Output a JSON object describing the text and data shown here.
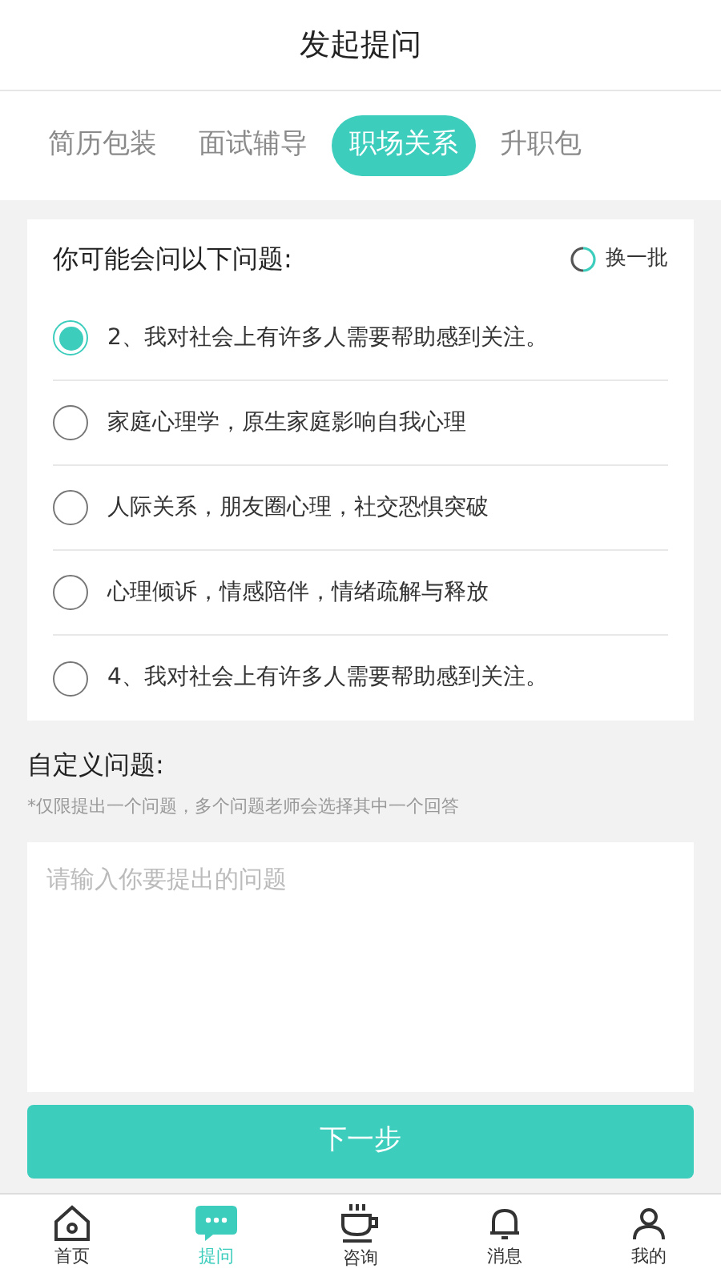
{
  "header": {
    "title": "发起提问"
  },
  "tabs": [
    {
      "label": "简历包装",
      "selected": false
    },
    {
      "label": "面试辅导",
      "selected": false
    },
    {
      "label": "职场关系",
      "selected": true
    },
    {
      "label": "升职包",
      "selected": false
    }
  ],
  "suggestions": {
    "title": "你可能会问以下问题:",
    "refresh": "换一批",
    "options": [
      {
        "label": "2、我对社会上有许多人需要帮助感到关注。",
        "selected": true
      },
      {
        "label": "家庭心理学，原生家庭影响自我心理",
        "selected": false
      },
      {
        "label": "人际关系，朋友圈心理，社交恐惧突破",
        "selected": false
      },
      {
        "label": "心理倾诉，情感陪伴，情绪疏解与释放",
        "selected": false
      },
      {
        "label": "4、我对社会上有许多人需要帮助感到关注。",
        "selected": false
      }
    ]
  },
  "custom": {
    "title": "自定义问题:",
    "note": "*仅限提出一个问题，多个问题老师会选择其中一个回答",
    "placeholder": "请输入你要提出的问题"
  },
  "next_button": "下一步",
  "bottom_nav": [
    {
      "kind": "home",
      "label": "首页",
      "selected": false
    },
    {
      "kind": "ask",
      "label": "提问",
      "selected": true
    },
    {
      "kind": "consult",
      "label": "咨询",
      "selected": false
    },
    {
      "kind": "message",
      "label": "消息",
      "selected": false
    },
    {
      "kind": "mine",
      "label": "我的",
      "selected": false
    }
  ]
}
